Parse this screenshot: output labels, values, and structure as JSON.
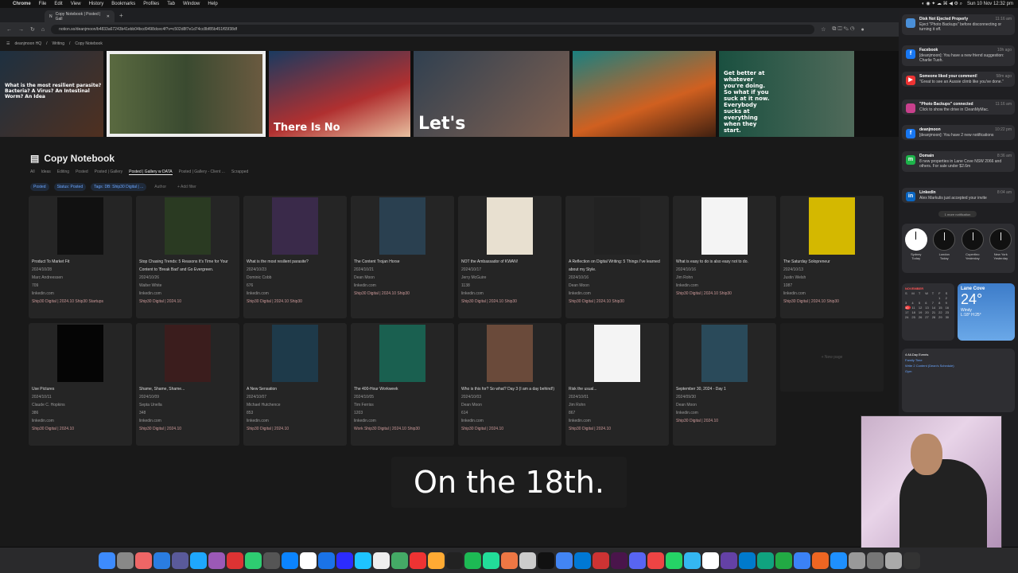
{
  "menubar": {
    "app": "Chrome",
    "items": [
      "File",
      "Edit",
      "View",
      "History",
      "Bookmarks",
      "Profiles",
      "Tab",
      "Window",
      "Help"
    ],
    "clock": "Sun 10 Nov 12:32 pm"
  },
  "browser": {
    "tab_title": "Copy Notebook | Posted | Gall",
    "url": "notion.so/deanjmoon/b4833a67243b41ebb04bcd9498dcec4f?v=c502d8f7e1d74cc8bf85b451f65f38df"
  },
  "breadcrumb": {
    "workspace": "deanjmoon HQ",
    "sep": "/",
    "section": "Writing",
    "page": "Copy Notebook"
  },
  "cover": [
    "What is the most resilient parasite? Bacteria? A Virus? An Intestinal Worm? An Idea",
    "",
    "There Is No",
    "Let's",
    "",
    "Get better at whatever you're doing. So what if you suck at it now. Everybody sucks at everything when they start."
  ],
  "database": {
    "title": "Copy Notebook",
    "views": [
      "All",
      "Ideas",
      "Editing",
      "Posted",
      "Posted | Gallery",
      "Posted | Gallery w DATA",
      "Posted | Gallery - Client ...",
      "Scrapped"
    ],
    "filters": [
      "Posted",
      "Status: Posted",
      "Tags: DB: Ship30 Digital | ...",
      "Author",
      "+ Add filter"
    ],
    "new_page": "+ New page"
  },
  "cards": [
    {
      "title": "Product To Market Fit",
      "date": "2024/10/28",
      "author": "Marc Andreessen",
      "num": "709",
      "link": "linkedin.com",
      "tags": "Ship30 Digital | 2024.10   Ship30   Startups"
    },
    {
      "title": "Stop Chasing Trends: 5 Reasons It's Time for Your Content to 'Break Bad' and Go Evergreen.",
      "date": "2024/10/26",
      "author": "Walter White",
      "num": "",
      "link": "linkedin.com",
      "tags": "Ship30 Digital | 2024.10"
    },
    {
      "title": "What is the most resilient parasite?",
      "date": "2024/10/23",
      "author": "Dominic Cobb",
      "num": "676",
      "link": "linkedin.com",
      "tags": "Ship30 Digital | 2024.10   Ship30"
    },
    {
      "title": "The Content Trojan Horse",
      "date": "2024/10/21",
      "author": "Dean Moon",
      "num": "",
      "link": "linkedin.com",
      "tags": "Ship30 Digital | 2024.10   Ship30"
    },
    {
      "title": "NOT the Ambassador of KWAN!",
      "date": "2024/10/17",
      "author": "Jerry McGuire",
      "num": "1138",
      "link": "linkedin.com",
      "tags": "Ship30 Digital | 2024.10   Ship30"
    },
    {
      "title": "A Reflection on Digital Writing: 5 Things I've learned about my Style.",
      "date": "2024/10/16",
      "author": "Dean Moon",
      "num": "",
      "link": "linkedin.com",
      "tags": "Ship30 Digital | 2024.10   Ship30"
    },
    {
      "title": "What is easy to do is also easy not to do.",
      "date": "2024/10/16",
      "author": "Jim Rohn",
      "num": "",
      "link": "linkedin.com",
      "tags": "Ship30 Digital | 2024.10   Ship30"
    },
    {
      "title": "The Saturday Solopreneur",
      "date": "2024/10/13",
      "author": "Justin Welsh",
      "num": "1087",
      "link": "linkedin.com",
      "tags": "Ship30 Digital | 2024.10   Ship30"
    },
    {
      "title": "Use Pictures",
      "date": "2024/10/11",
      "author": "Claude C. Hopkins",
      "num": "386",
      "link": "linkedin.com",
      "tags": "Ship30 Digital | 2024.10"
    },
    {
      "title": "Shame, Shame, Shame...",
      "date": "2024/10/09",
      "author": "Septa Unella",
      "num": "348",
      "link": "linkedin.com",
      "tags": "Ship30 Digital | 2024.10"
    },
    {
      "title": "A New Sensation",
      "date": "2024/10/07",
      "author": "Michael Hutchence",
      "num": "853",
      "link": "linkedin.com",
      "tags": "Ship30 Digital | 2024.10"
    },
    {
      "title": "The 400-Hour Workweek",
      "date": "2024/10/05",
      "author": "Tim Ferriss",
      "num": "1203",
      "link": "linkedin.com",
      "tags": "Work   Ship30 Digital | 2024.10   Ship30"
    },
    {
      "title": "Who is this for? So what? Day 3 (I am a day behind!)",
      "date": "2024/10/03",
      "author": "Dean Moon",
      "num": "614",
      "link": "linkedin.com",
      "tags": "Ship30 Digital | 2024.10"
    },
    {
      "title": "Risk the usual...",
      "date": "2024/10/01",
      "author": "Jim Rohn",
      "num": "867",
      "link": "linkedin.com",
      "tags": "Ship30 Digital | 2024.10"
    },
    {
      "title": "September 30, 2024 - Day 1",
      "date": "2024/09/30",
      "author": "Dean Moon",
      "num": "",
      "link": "linkedin.com",
      "tags": "Ship30 Digital | 2024.10"
    }
  ],
  "thumb_colors": [
    "#111",
    "#2a3a22",
    "#3a2a4a",
    "#2a4050",
    "#e8e0d0",
    "#222",
    "#f4f4f4",
    "#d4b800",
    "#050505",
    "#3b1d1d",
    "#1e3a4a",
    "#1a6050",
    "#6a4a3a",
    "#f4f4f4",
    "#2a4a5a"
  ],
  "subtitle": "On the 18th.",
  "notifications": [
    {
      "icon": "",
      "color": "#4a8fd8",
      "head": "Disk Not Ejected Properly",
      "body": "Eject \"Photo Backups\" before disconnecting or turning it off.",
      "time": "11:16 am"
    },
    {
      "icon": "f",
      "color": "#1877f2",
      "head": "Facebook",
      "body": "[deanjmoon]: You have a new friend suggestion: Charlie Tuoh.",
      "time": "10h ago"
    },
    {
      "icon": "▶",
      "color": "#e33",
      "head": "Someone liked your comment!",
      "body": "\"Great to see an Aussie climb like you've done.\"",
      "time": "58m ago"
    },
    {
      "icon": "",
      "color": "#c8408c",
      "head": "\"Photo Backups\" connected",
      "body": "Click to show the drive in CleanMyMac.",
      "time": "11:16 am"
    },
    {
      "icon": "f",
      "color": "#1877f2",
      "head": "deanjmoon",
      "body": "[deanjmoon]: You have 2 new notifications",
      "time": "10:22 pm"
    },
    {
      "icon": "m",
      "color": "#1db34a",
      "head": "Domain",
      "body": "8 new properties in Lane Cove NSW 2066 and others. For sale under $2.6m",
      "time": "8:36 am"
    },
    {
      "icon": "in",
      "color": "#0a66c2",
      "head": "LinkedIn",
      "body": "Alex Markulis just accepted your invite",
      "time": "8:04 am"
    }
  ],
  "more_notifications": "1 more notification",
  "clocks": [
    {
      "city": "Sydney",
      "rel": "Today"
    },
    {
      "city": "London",
      "rel": "Today"
    },
    {
      "city": "Cupertino",
      "rel": "Yesterday"
    },
    {
      "city": "New York",
      "rel": "Yesterday"
    }
  ],
  "calendar": {
    "month": "NOVEMBER",
    "days": [
      "S",
      "M",
      "T",
      "W",
      "T",
      "F",
      "S"
    ],
    "today": "10"
  },
  "weather": {
    "city": "Lane Cove",
    "temp": "24°",
    "desc": "Windy",
    "range": "L:18° H:25°"
  },
  "events": {
    "head": "4 All-Day Events",
    "items": [
      "Family Time",
      "Write 2 Content (Dean's Schedule)",
      "Gym"
    ]
  },
  "colors": {
    "accent": "#6aa6ff",
    "notion_bg": "#191919",
    "card_bg": "#252525"
  }
}
